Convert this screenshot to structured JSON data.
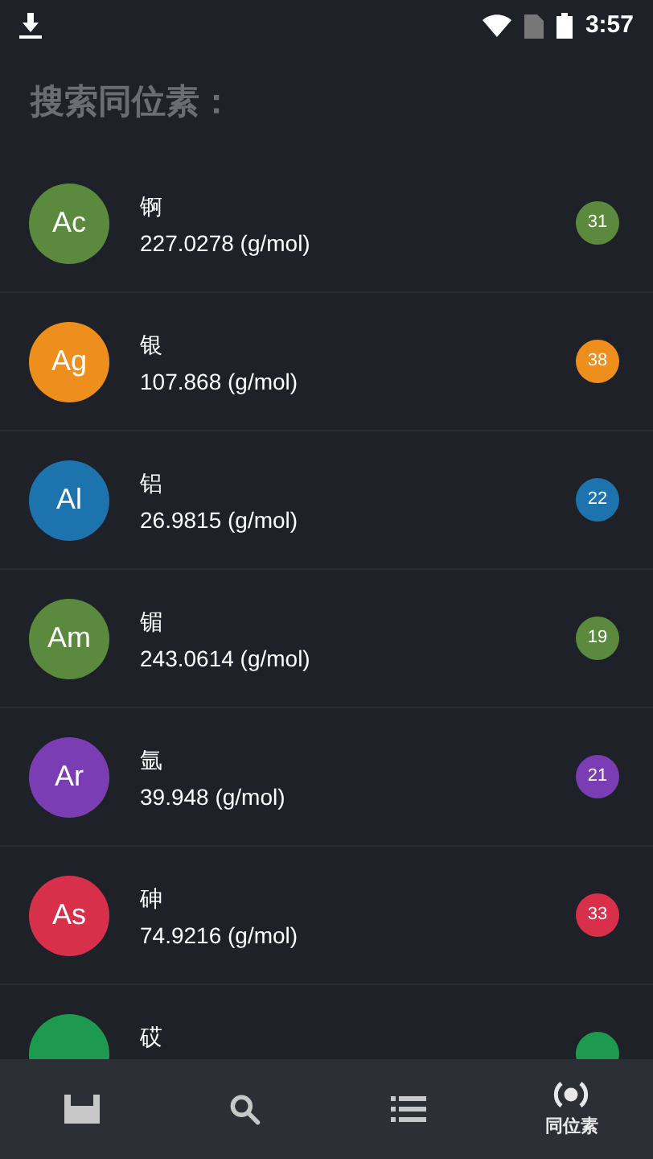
{
  "status_bar": {
    "time": "3:57"
  },
  "title": "搜索同位素：",
  "elements": [
    {
      "symbol": "Ac",
      "name": "锕",
      "mass": "227.0278 (g/mol)",
      "count": "31",
      "color": "#5b8a3e"
    },
    {
      "symbol": "Ag",
      "name": "银",
      "mass": "107.868 (g/mol)",
      "count": "38",
      "color": "#ee8e1c"
    },
    {
      "symbol": "Al",
      "name": "铝",
      "mass": "26.9815 (g/mol)",
      "count": "22",
      "color": "#1c73ae"
    },
    {
      "symbol": "Am",
      "name": "镅",
      "mass": "243.0614 (g/mol)",
      "count": "19",
      "color": "#5b8a3e"
    },
    {
      "symbol": "Ar",
      "name": "氩",
      "mass": "39.948 (g/mol)",
      "count": "21",
      "color": "#7a3db3"
    },
    {
      "symbol": "As",
      "name": "砷",
      "mass": "74.9216 (g/mol)",
      "count": "33",
      "color": "#d8304a"
    },
    {
      "name": "砹",
      "color": "#1e9a50"
    }
  ],
  "nav": [
    {
      "kind": "table",
      "selected": false
    },
    {
      "kind": "search",
      "selected": false
    },
    {
      "kind": "list",
      "selected": false
    },
    {
      "kind": "isotope",
      "label": "同位素",
      "selected": true
    }
  ]
}
